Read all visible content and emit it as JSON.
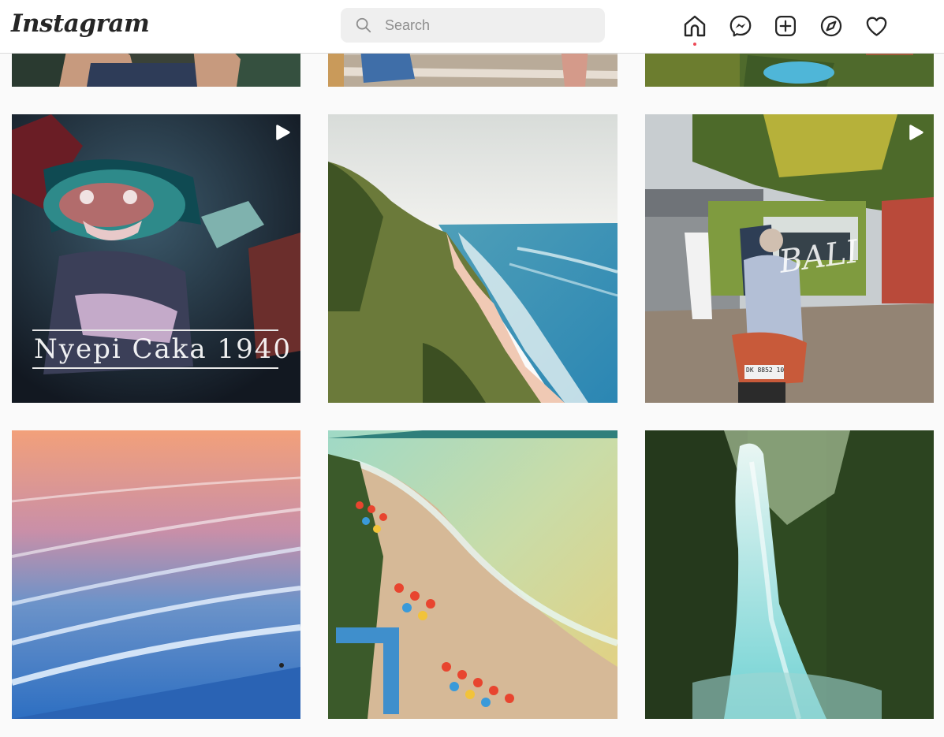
{
  "header": {
    "logo_text": "Instagram",
    "search": {
      "placeholder": "Search",
      "value": ""
    },
    "nav": [
      "home-icon",
      "messenger-icon",
      "new-post-icon",
      "explore-icon",
      "activity-heart-icon"
    ],
    "notification_dot_color": "#ed4956",
    "icon_color": "#262626"
  },
  "grid": {
    "tiles": [
      {
        "id": "partial-1",
        "reel": false
      },
      {
        "id": "partial-2",
        "reel": false
      },
      {
        "id": "partial-3",
        "reel": false
      },
      {
        "id": "nyepi",
        "reel": true,
        "overlay_text": "Nyepi Caka 1940"
      },
      {
        "id": "cliff-beach",
        "reel": false
      },
      {
        "id": "bali-street",
        "reel": true,
        "overlay_text": "BALI",
        "plate_text": "DK 8852 10"
      },
      {
        "id": "sunset-waves",
        "reel": false
      },
      {
        "id": "umbrella-beach",
        "reel": false
      },
      {
        "id": "waterfall",
        "reel": false
      }
    ]
  }
}
